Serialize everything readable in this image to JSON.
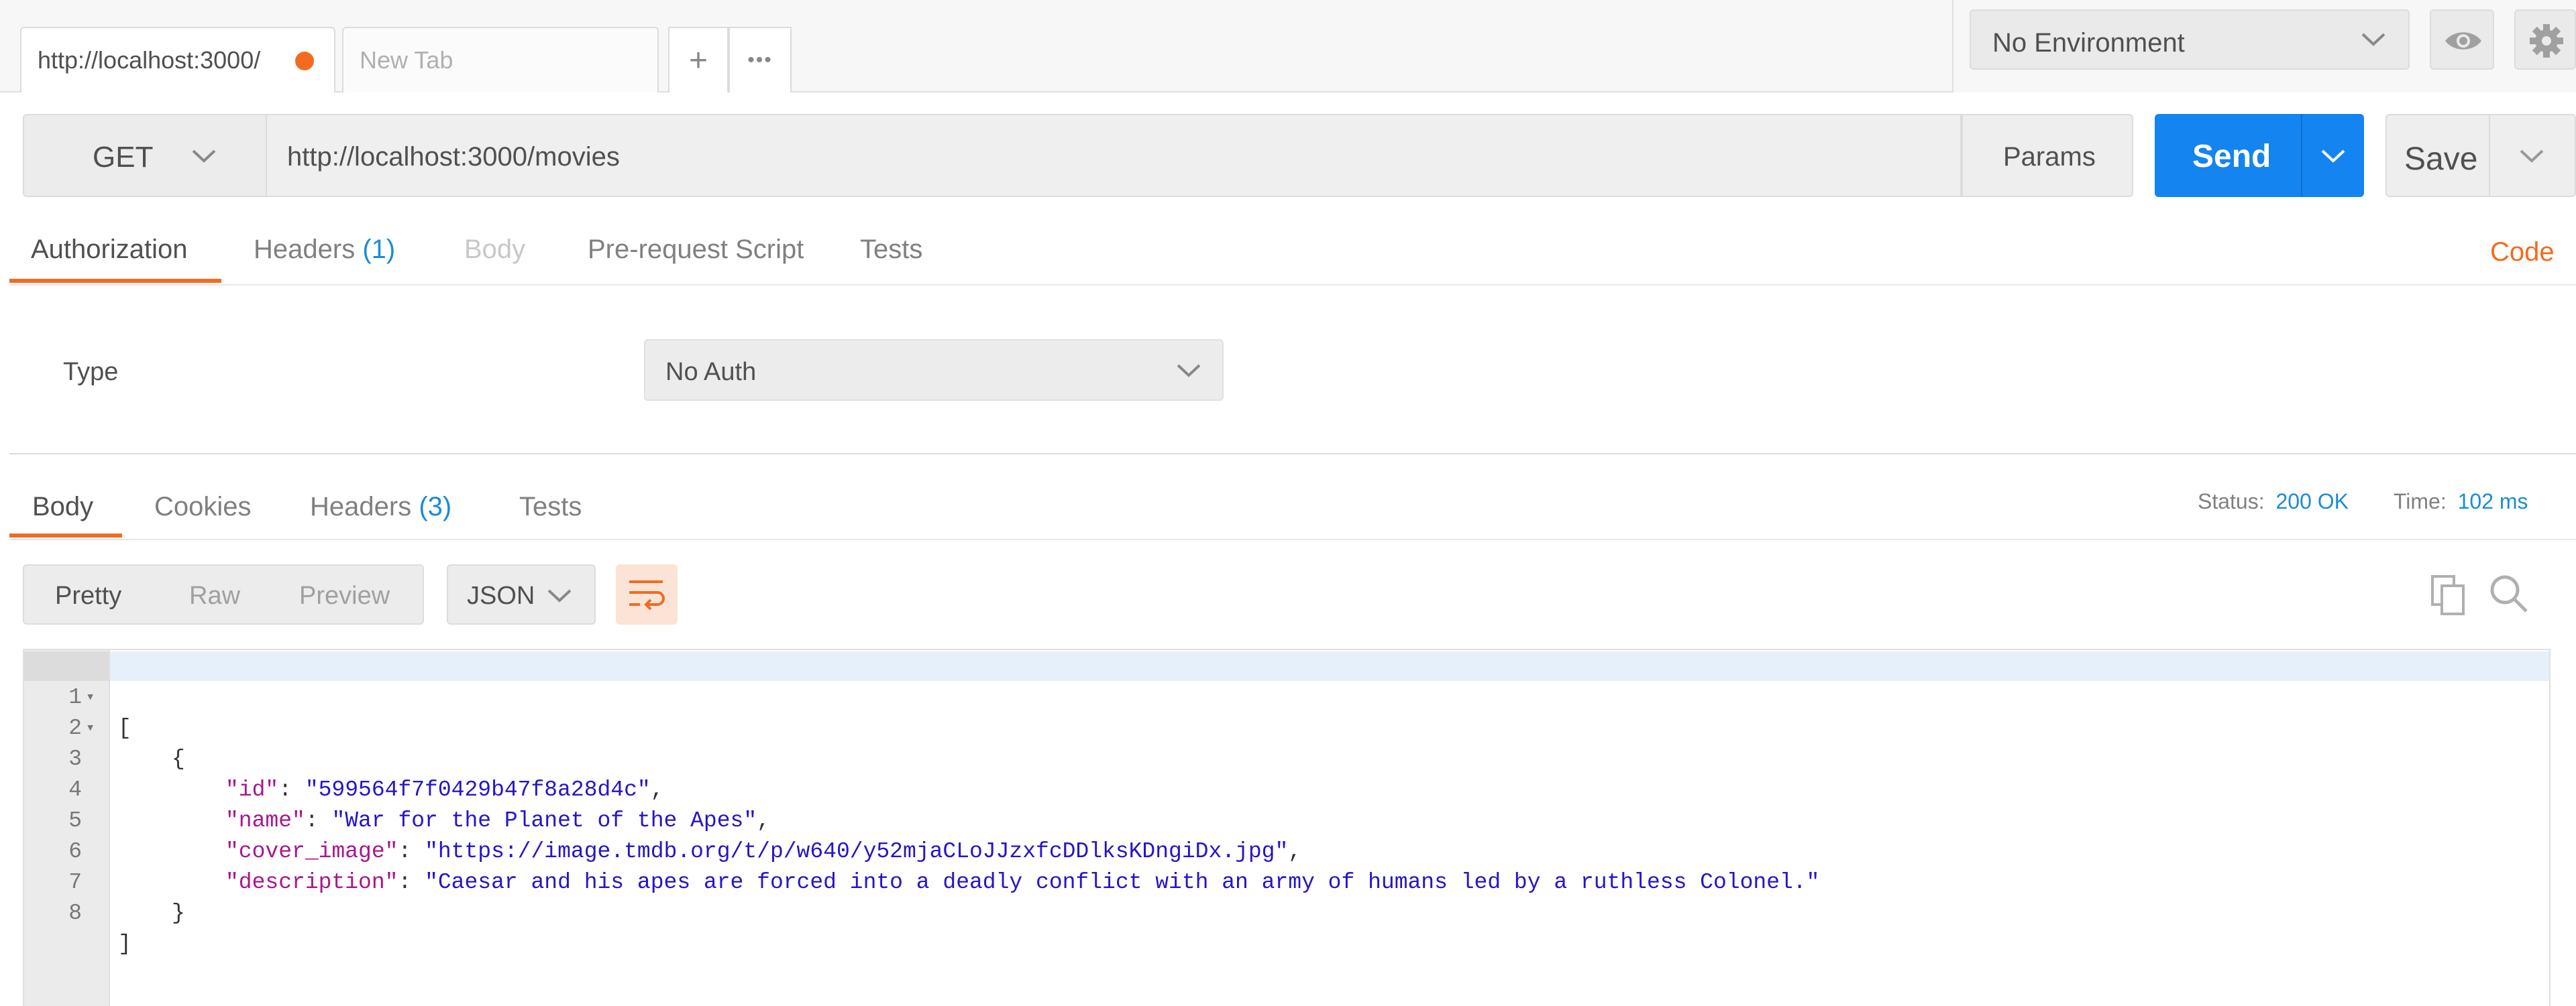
{
  "tabs": [
    {
      "label": "http://localhost:3000/",
      "unsaved": true
    },
    {
      "label": "New Tab",
      "placeholder": true
    }
  ],
  "tab_actions": {
    "add": "+",
    "more": "•••"
  },
  "environment": {
    "selected": "No Environment"
  },
  "request": {
    "method": "GET",
    "url": "http://localhost:3000/movies",
    "params_label": "Params",
    "send_label": "Send",
    "save_label": "Save"
  },
  "request_tabs": {
    "authorization": "Authorization",
    "headers": "Headers",
    "headers_count": "(1)",
    "body": "Body",
    "prerequest": "Pre-request Script",
    "tests": "Tests",
    "code_link": "Code"
  },
  "auth": {
    "type_label": "Type",
    "type_value": "No Auth"
  },
  "response_tabs": {
    "body": "Body",
    "cookies": "Cookies",
    "headers": "Headers",
    "headers_count": "(3)",
    "tests": "Tests"
  },
  "status": {
    "status_label": "Status:",
    "status_value": "200 OK",
    "time_label": "Time:",
    "time_value": "102 ms"
  },
  "view_modes": {
    "pretty": "Pretty",
    "raw": "Raw",
    "preview": "Preview",
    "format": "JSON"
  },
  "response_body": {
    "line_numbers": [
      "1",
      "2",
      "3",
      "4",
      "5",
      "6",
      "7",
      "8"
    ],
    "open_bracket": "[",
    "open_brace": "{",
    "fields": [
      {
        "key": "\"id\"",
        "value": "\"599564f7f0429b47f8a28d4c\""
      },
      {
        "key": "\"name\"",
        "value": "\"War for the Planet of the Apes\""
      },
      {
        "key": "\"cover_image\"",
        "value": "\"https://image.tmdb.org/t/p/w640/y52mjaCLoJJzxfcDDlksKDngiDx.jpg\""
      },
      {
        "key": "\"description\"",
        "value": "\"Caesar and his apes are forced into a deadly conflict with an army of humans led by a ruthless Colonel.\""
      }
    ],
    "close_brace": "}",
    "close_bracket": "]"
  },
  "colors": {
    "accent": "#f26b21",
    "primary": "#1484f0",
    "link": "#1a8cd8"
  }
}
